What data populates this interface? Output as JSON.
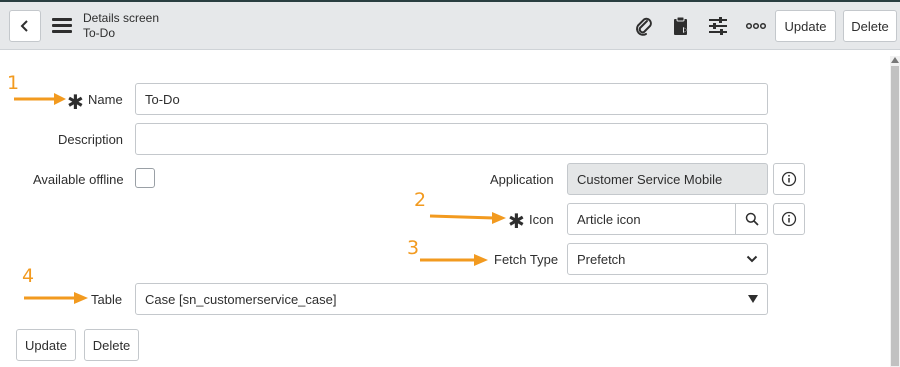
{
  "header": {
    "title": "Details screen",
    "subtitle": "To-Do",
    "update_label": "Update",
    "delete_label": "Delete",
    "icons": [
      "back-icon",
      "menu-icon",
      "paperclip-icon",
      "clipboard-icon",
      "sliders-icon",
      "more-icon"
    ]
  },
  "form": {
    "name_label": "Name",
    "name_value": "To-Do",
    "description_label": "Description",
    "description_value": "",
    "offline_label": "Available offline",
    "offline_checked": false,
    "application_label": "Application",
    "application_value": "Customer Service Mobile",
    "icon_label": "Icon",
    "icon_value": "Article icon",
    "fetch_label": "Fetch Type",
    "fetch_value": "Prefetch",
    "table_label": "Table",
    "table_value": "Case [sn_customerservice_case]"
  },
  "footer": {
    "update_label": "Update",
    "delete_label": "Delete"
  },
  "annotations": [
    "1",
    "2",
    "3",
    "4"
  ],
  "colors": {
    "accent": "#f29a1f",
    "header_bg": "#e6e8ea",
    "top_line": "#293e40"
  }
}
